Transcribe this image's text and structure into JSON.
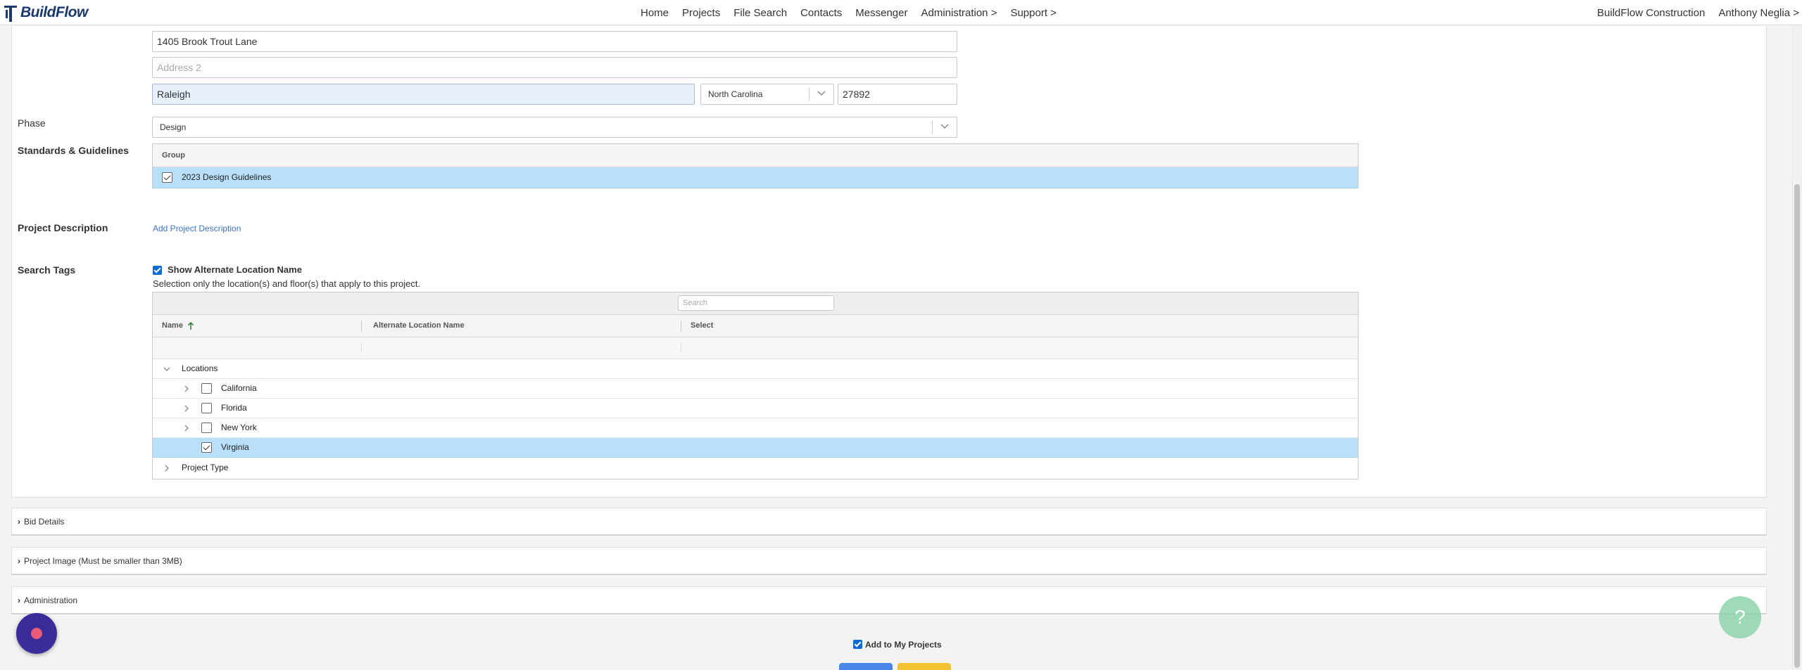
{
  "app": {
    "name": "BuildFlow"
  },
  "nav": {
    "items": [
      "Home",
      "Projects",
      "File Search",
      "Contacts",
      "Messenger",
      "Administration >",
      "Support >"
    ],
    "company": "BuildFlow Construction",
    "user": "Anthony Neglia >"
  },
  "address": {
    "line1": "1405 Brook Trout Lane",
    "line2_placeholder": "Address 2",
    "city": "Raleigh",
    "state": "North Carolina",
    "zip": "27892"
  },
  "phase": {
    "label": "Phase",
    "value": "Design"
  },
  "standards": {
    "label": "Standards & Guidelines",
    "column": "Group",
    "rows": [
      {
        "name": "2023 Design Guidelines",
        "checked": true
      }
    ]
  },
  "description": {
    "label": "Project Description",
    "link": "Add Project Description"
  },
  "search_tags": {
    "label": "Search Tags",
    "show_alt_label": "Show Alternate Location Name",
    "instruction": "Selection only the location(s) and floor(s) that apply to this project.",
    "search_placeholder": "Search",
    "columns": {
      "name": "Name",
      "sort_icon": "arrow-up",
      "alt": "Alternate Location Name",
      "select": "Select"
    },
    "tree": {
      "group1": "Locations",
      "children": [
        {
          "name": "California",
          "checked": false
        },
        {
          "name": "Florida",
          "checked": false
        },
        {
          "name": "New York",
          "checked": false
        },
        {
          "name": "Virginia",
          "checked": true
        }
      ],
      "group2": "Project Type"
    }
  },
  "sections": [
    "Bid Details",
    "Project Image (Must be smaller than 3MB)",
    "Administration"
  ],
  "footer": {
    "add_to_my_projects": "Add to My Projects"
  },
  "colors": {
    "selected_row": "#b9e0fa",
    "link": "#3b73c4",
    "checkbox": "#0b6bd3",
    "primary_button": "#4a86e8",
    "warning_button": "#f1c232",
    "help_button": "#8fd4ad",
    "chat_button": "#3a2d99"
  },
  "icons": {
    "help": "question-mark-icon",
    "chat": "chat-bubble-icon"
  }
}
